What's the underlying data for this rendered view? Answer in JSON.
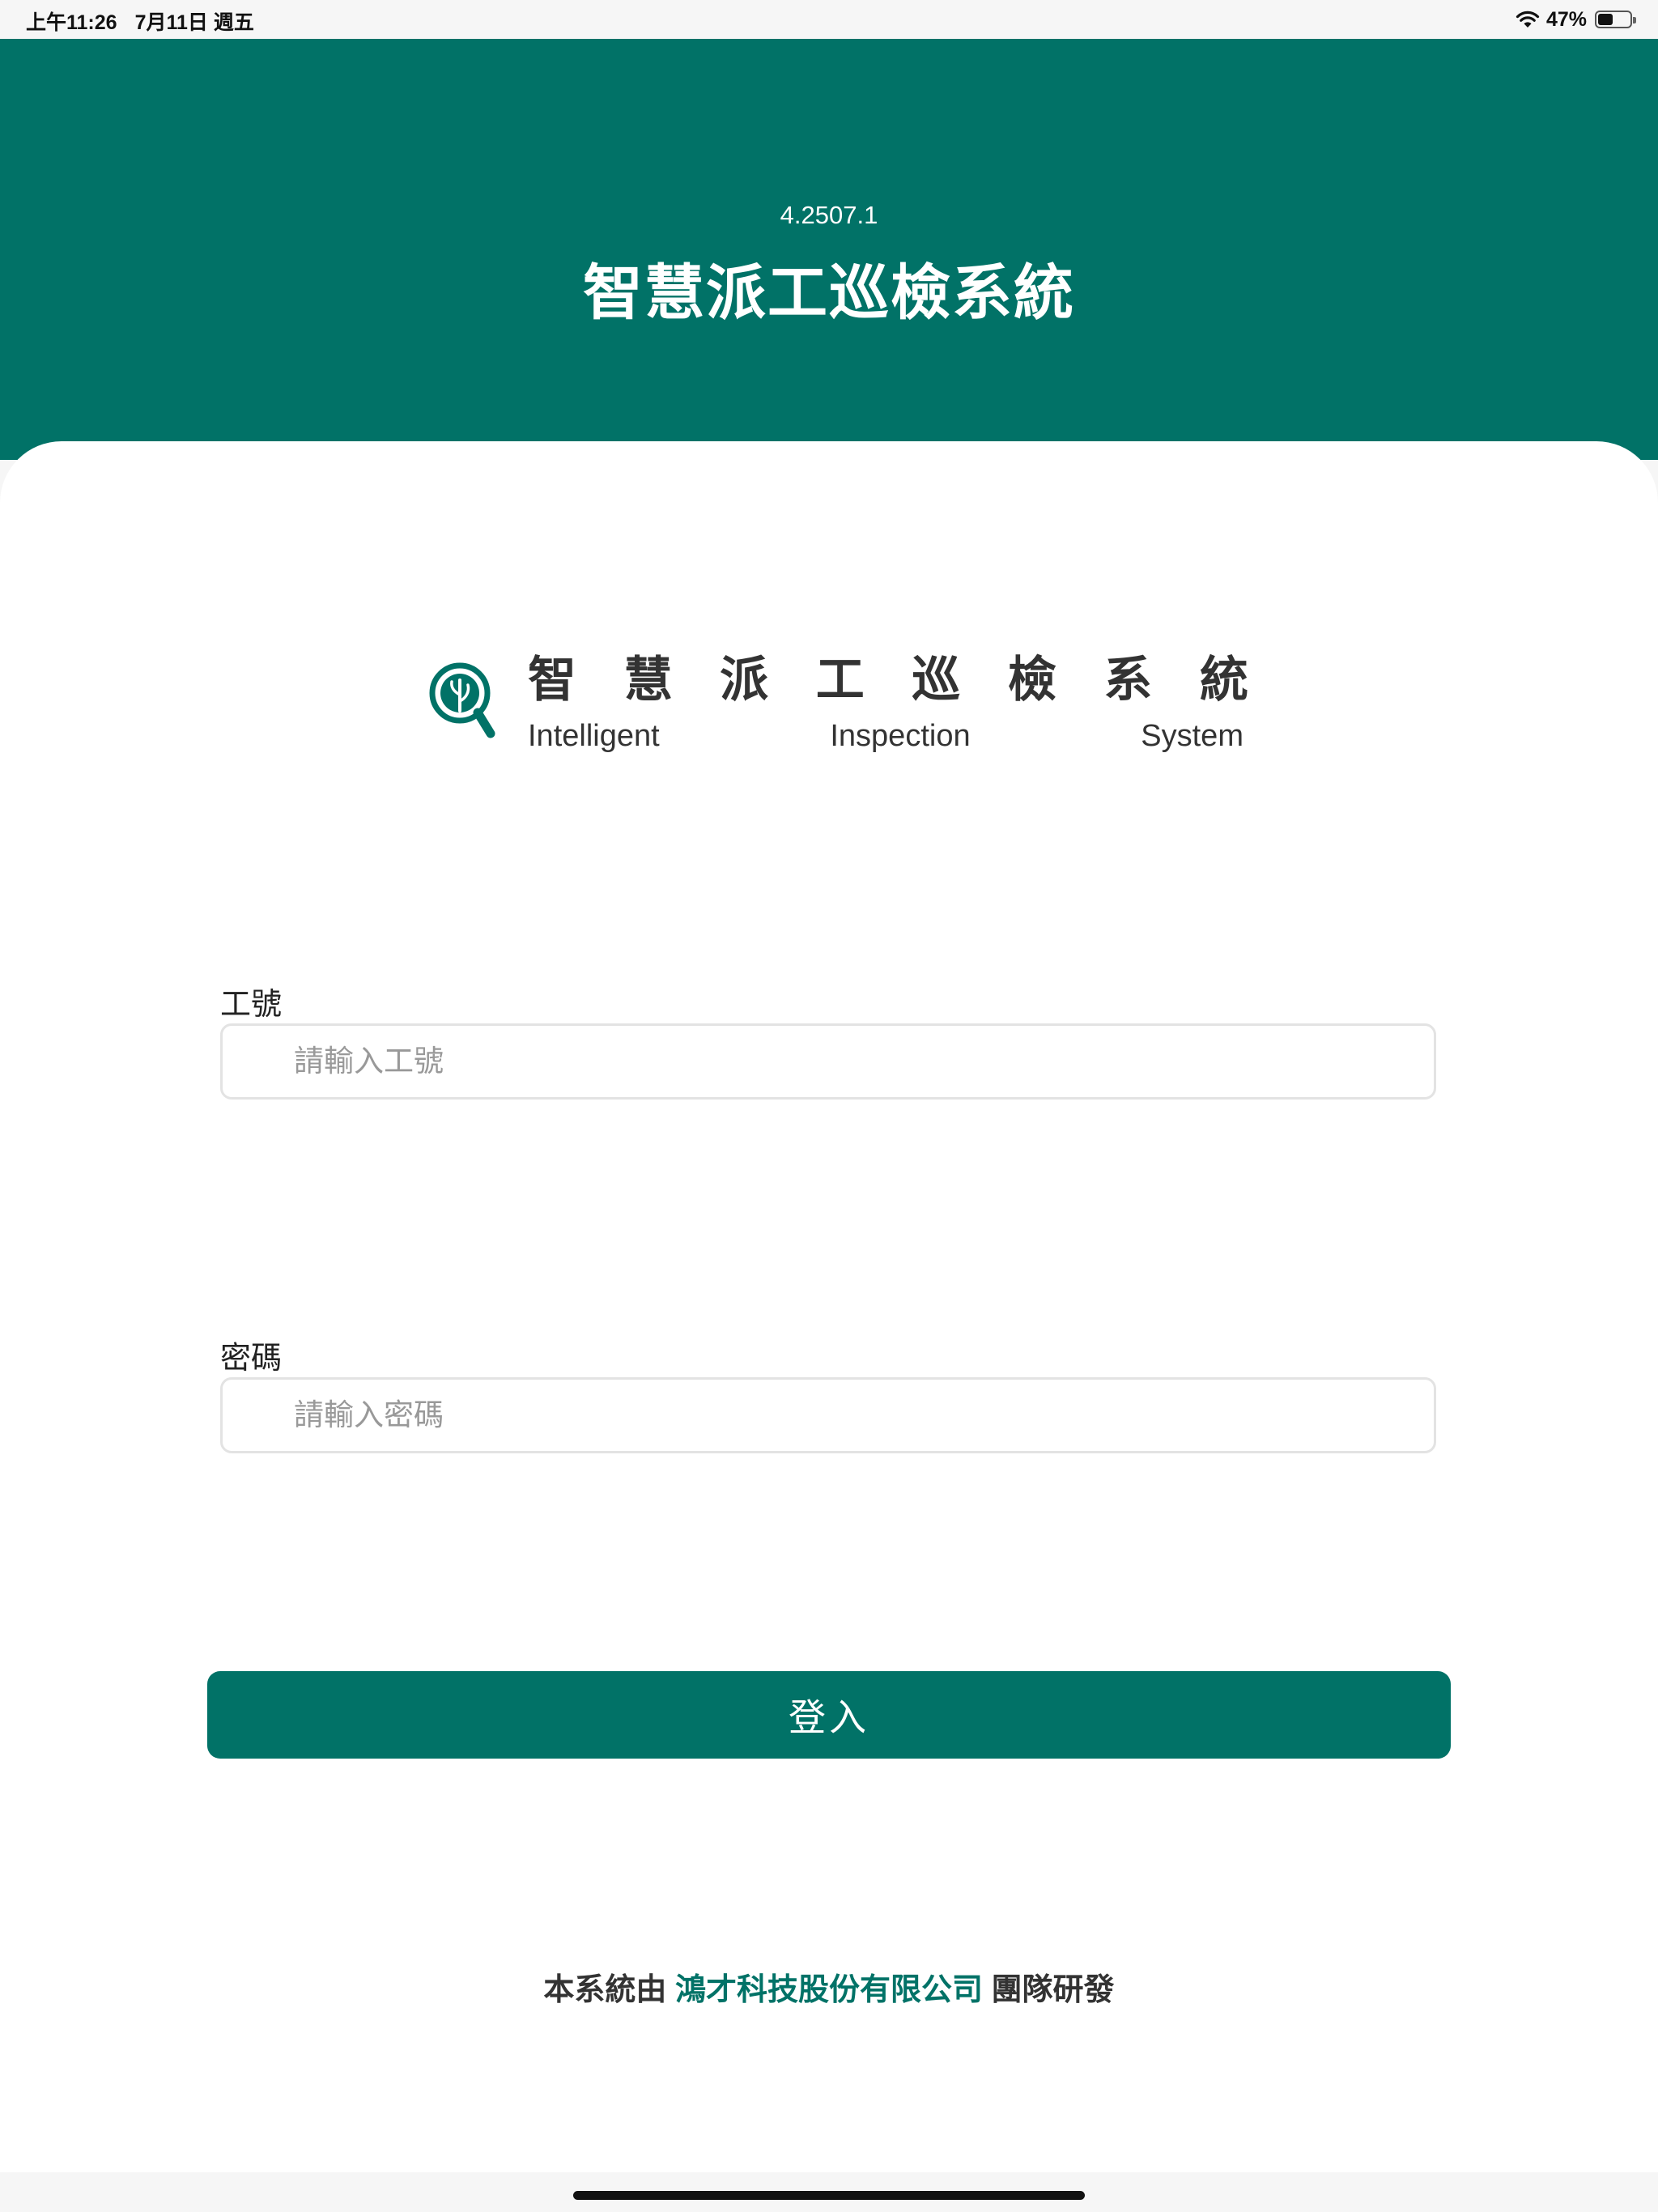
{
  "status_bar": {
    "time": "上午11:26",
    "date": "7月11日 週五",
    "battery_percent": "47%",
    "battery_level": 0.47,
    "wifi_icon": "wifi-icon",
    "battery_icon": "battery-icon"
  },
  "header": {
    "version": "4.2507.1",
    "title": "智慧派工巡檢系統"
  },
  "logo": {
    "icon": "magnifier-leaf-icon",
    "chars": [
      "智",
      "慧",
      "派",
      "工",
      "巡",
      "檢",
      "系",
      "統"
    ],
    "en_words": [
      "Intelligent",
      "Inspection",
      "System"
    ]
  },
  "form": {
    "employee_id": {
      "label": "工號",
      "placeholder": "請輸入工號",
      "value": ""
    },
    "password": {
      "label": "密碼",
      "placeholder": "請輸入密碼",
      "value": ""
    },
    "login_label": "登入"
  },
  "footer": {
    "prefix": "本系統由 ",
    "company": "鴻才科技股份有限公司",
    "suffix": " 團隊研發"
  },
  "colors": {
    "primary": "#017267",
    "background": "#ffffff",
    "input_border": "#e3e3e3"
  }
}
